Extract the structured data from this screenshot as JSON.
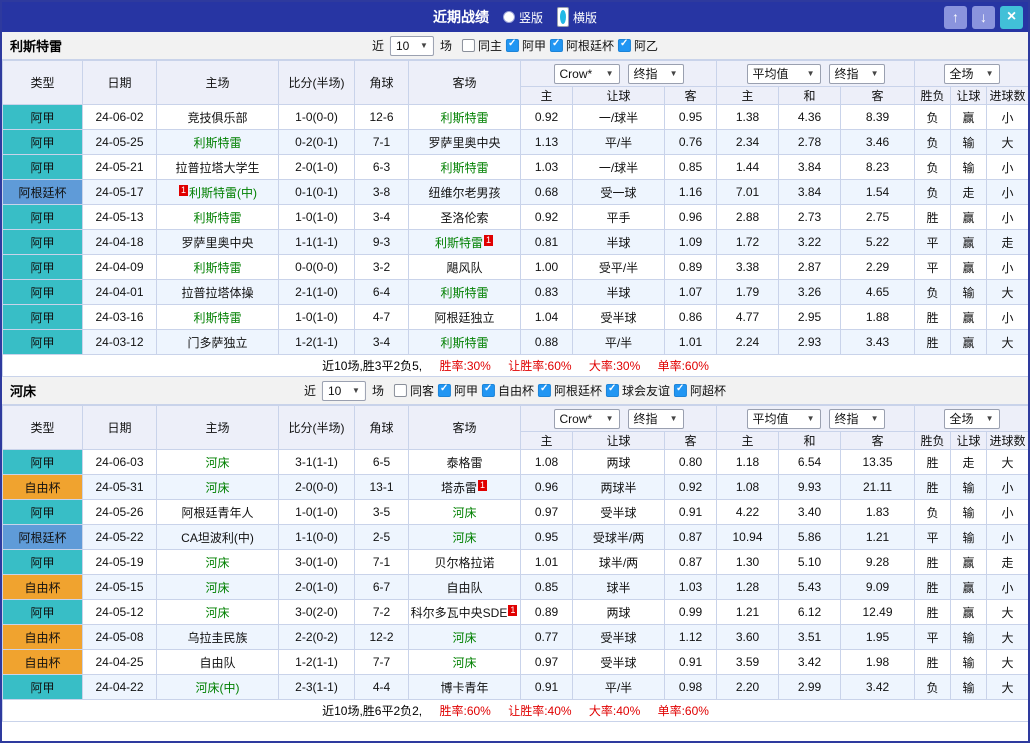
{
  "titlebar": {
    "title": "近期战绩",
    "vertical_label": "竖版",
    "horizontal_label": "横版",
    "selected_layout": "横版",
    "up_icon": "↑",
    "down_icon": "↓",
    "close_icon": "×"
  },
  "labels": {
    "recent_prefix": "近",
    "recent_suffix": "场"
  },
  "table_header": {
    "left_cols": [
      "类型",
      "日期",
      "主场",
      "比分(半场)",
      "角球",
      "客场"
    ],
    "company_select": "Crow*",
    "final_select": "终指",
    "avg_select": "平均值",
    "avg_final_select": "终指",
    "scope_select": "全场",
    "sub_cols": [
      "主",
      "让球",
      "客",
      "主",
      "和",
      "客",
      "胜负",
      "让球",
      "进球数"
    ]
  },
  "colors": {
    "titlebar_bg": "#2735a3",
    "nav_btn": "#8a94dd",
    "close_btn": "#41c0d8",
    "league": {
      "阿甲": "#38bec6",
      "阿根廷杯": "#5f9bd8",
      "自由杯": "#f0a32f",
      "阿乙": "#38bec6"
    },
    "focus_team": "#008000",
    "score": "#e00000",
    "win": "#e00000",
    "draw": "#008800",
    "loss": "#0000cc",
    "header_bg": "#edeff9",
    "row_alt": "#eef5fe"
  },
  "sections": [
    {
      "team": "利斯特雷",
      "matches_select": "10",
      "filters": [
        {
          "label": "同主",
          "checked": false
        },
        {
          "label": "阿甲",
          "checked": true
        },
        {
          "label": "阿根廷杯",
          "checked": true
        },
        {
          "label": "阿乙",
          "checked": true
        }
      ],
      "rows": [
        {
          "league": "阿甲",
          "date": "24-06-02",
          "home": {
            "name": "竞技俱乐部"
          },
          "score": "1-0(0-0)",
          "corners": "12-6",
          "away": {
            "name": "利斯特雷",
            "focus": true
          },
          "odds": [
            "0.92",
            "一/球半",
            "0.95"
          ],
          "avg": [
            "1.38",
            "4.36",
            "8.39"
          ],
          "results": [
            "负",
            "赢",
            "小"
          ]
        },
        {
          "league": "阿甲",
          "date": "24-05-25",
          "home": {
            "name": "利斯特雷",
            "focus": true
          },
          "score": "0-2(0-1)",
          "corners": "7-1",
          "away": {
            "name": "罗萨里奥中央"
          },
          "odds": [
            "1.13",
            "平/半",
            "0.76"
          ],
          "avg": [
            "2.34",
            "2.78",
            "3.46"
          ],
          "results": [
            "负",
            "输",
            "大"
          ]
        },
        {
          "league": "阿甲",
          "date": "24-05-21",
          "home": {
            "name": "拉普拉塔大学生"
          },
          "score": "2-0(1-0)",
          "corners": "6-3",
          "away": {
            "name": "利斯特雷",
            "focus": true
          },
          "odds": [
            "1.03",
            "一/球半",
            "0.85"
          ],
          "avg": [
            "1.44",
            "3.84",
            "8.23"
          ],
          "results": [
            "负",
            "输",
            "小"
          ]
        },
        {
          "league": "阿根廷杯",
          "date": "24-05-17",
          "home": {
            "name": "利斯特雷(中)",
            "focus": true,
            "badge_pos": "before",
            "badge_text": "1"
          },
          "score": "0-1(0-1)",
          "corners": "3-8",
          "away": {
            "name": "纽维尔老男孩"
          },
          "odds": [
            "0.68",
            "受一球",
            "1.16"
          ],
          "avg": [
            "7.01",
            "3.84",
            "1.54"
          ],
          "results": [
            "负",
            "走",
            "小"
          ]
        },
        {
          "league": "阿甲",
          "date": "24-05-13",
          "home": {
            "name": "利斯特雷",
            "focus": true
          },
          "score": "1-0(1-0)",
          "corners": "3-4",
          "away": {
            "name": "圣洛伦索"
          },
          "odds": [
            "0.92",
            "平手",
            "0.96"
          ],
          "avg": [
            "2.88",
            "2.73",
            "2.75"
          ],
          "results": [
            "胜",
            "赢",
            "小"
          ]
        },
        {
          "league": "阿甲",
          "date": "24-04-18",
          "home": {
            "name": "罗萨里奥中央"
          },
          "score": "1-1(1-1)",
          "corners": "9-3",
          "away": {
            "name": "利斯特雷",
            "focus": true,
            "badge_pos": "after",
            "badge_text": "1"
          },
          "odds": [
            "0.81",
            "半球",
            "1.09"
          ],
          "avg": [
            "1.72",
            "3.22",
            "5.22"
          ],
          "results": [
            "平",
            "赢",
            "走"
          ]
        },
        {
          "league": "阿甲",
          "date": "24-04-09",
          "home": {
            "name": "利斯特雷",
            "focus": true
          },
          "score": "0-0(0-0)",
          "corners": "3-2",
          "away": {
            "name": "飓风队"
          },
          "odds": [
            "1.00",
            "受平/半",
            "0.89"
          ],
          "avg": [
            "3.38",
            "2.87",
            "2.29"
          ],
          "results": [
            "平",
            "赢",
            "小"
          ]
        },
        {
          "league": "阿甲",
          "date": "24-04-01",
          "home": {
            "name": "拉普拉塔体操"
          },
          "score": "2-1(1-0)",
          "corners": "6-4",
          "away": {
            "name": "利斯特雷",
            "focus": true
          },
          "odds": [
            "0.83",
            "半球",
            "1.07"
          ],
          "avg": [
            "1.79",
            "3.26",
            "4.65"
          ],
          "results": [
            "负",
            "输",
            "大"
          ]
        },
        {
          "league": "阿甲",
          "date": "24-03-16",
          "home": {
            "name": "利斯特雷",
            "focus": true
          },
          "score": "1-0(1-0)",
          "corners": "4-7",
          "away": {
            "name": "阿根廷独立"
          },
          "odds": [
            "1.04",
            "受半球",
            "0.86"
          ],
          "avg": [
            "4.77",
            "2.95",
            "1.88"
          ],
          "results": [
            "胜",
            "赢",
            "小"
          ]
        },
        {
          "league": "阿甲",
          "date": "24-03-12",
          "home": {
            "name": "门多萨独立"
          },
          "score": "1-2(1-1)",
          "corners": "3-4",
          "away": {
            "name": "利斯特雷",
            "focus": true
          },
          "odds": [
            "0.88",
            "平/半",
            "1.01"
          ],
          "avg": [
            "2.24",
            "2.93",
            "3.43"
          ],
          "results": [
            "胜",
            "赢",
            "大"
          ]
        }
      ],
      "summary": {
        "intro": "近10场,胜3平2负5,",
        "stats": [
          "胜率:30%",
          "让胜率:60%",
          "大率:30%",
          "单率:60%"
        ]
      }
    },
    {
      "team": "河床",
      "matches_select": "10",
      "filters": [
        {
          "label": "同客",
          "checked": false
        },
        {
          "label": "阿甲",
          "checked": true
        },
        {
          "label": "自由杯",
          "checked": true
        },
        {
          "label": "阿根廷杯",
          "checked": true
        },
        {
          "label": "球会友谊",
          "checked": true
        },
        {
          "label": "阿超杯",
          "checked": true
        }
      ],
      "rows": [
        {
          "league": "阿甲",
          "date": "24-06-03",
          "home": {
            "name": "河床",
            "focus": true
          },
          "score": "3-1(1-1)",
          "corners": "6-5",
          "away": {
            "name": "泰格雷"
          },
          "odds": [
            "1.08",
            "两球",
            "0.80"
          ],
          "avg": [
            "1.18",
            "6.54",
            "13.35"
          ],
          "results": [
            "胜",
            "走",
            "大"
          ]
        },
        {
          "league": "自由杯",
          "date": "24-05-31",
          "home": {
            "name": "河床",
            "focus": true
          },
          "score": "2-0(0-0)",
          "corners": "13-1",
          "away": {
            "name": "塔赤雷",
            "badge_pos": "after",
            "badge_text": "1"
          },
          "odds": [
            "0.96",
            "两球半",
            "0.92"
          ],
          "avg": [
            "1.08",
            "9.93",
            "21.11"
          ],
          "results": [
            "胜",
            "输",
            "小"
          ]
        },
        {
          "league": "阿甲",
          "date": "24-05-26",
          "home": {
            "name": "阿根廷青年人"
          },
          "score": "1-0(1-0)",
          "corners": "3-5",
          "away": {
            "name": "河床",
            "focus": true
          },
          "odds": [
            "0.97",
            "受半球",
            "0.91"
          ],
          "avg": [
            "4.22",
            "3.40",
            "1.83"
          ],
          "results": [
            "负",
            "输",
            "小"
          ]
        },
        {
          "league": "阿根廷杯",
          "date": "24-05-22",
          "home": {
            "name": "CA坦波利(中)"
          },
          "score": "1-1(0-0)",
          "corners": "2-5",
          "away": {
            "name": "河床",
            "focus": true
          },
          "odds": [
            "0.95",
            "受球半/两",
            "0.87"
          ],
          "avg": [
            "10.94",
            "5.86",
            "1.21"
          ],
          "results": [
            "平",
            "输",
            "小"
          ]
        },
        {
          "league": "阿甲",
          "date": "24-05-19",
          "home": {
            "name": "河床",
            "focus": true
          },
          "score": "3-0(1-0)",
          "corners": "7-1",
          "away": {
            "name": "贝尔格拉诺"
          },
          "odds": [
            "1.01",
            "球半/两",
            "0.87"
          ],
          "avg": [
            "1.30",
            "5.10",
            "9.28"
          ],
          "results": [
            "胜",
            "赢",
            "走"
          ]
        },
        {
          "league": "自由杯",
          "date": "24-05-15",
          "home": {
            "name": "河床",
            "focus": true
          },
          "score": "2-0(1-0)",
          "corners": "6-7",
          "away": {
            "name": "自由队"
          },
          "odds": [
            "0.85",
            "球半",
            "1.03"
          ],
          "avg": [
            "1.28",
            "5.43",
            "9.09"
          ],
          "results": [
            "胜",
            "赢",
            "小"
          ]
        },
        {
          "league": "阿甲",
          "date": "24-05-12",
          "home": {
            "name": "河床",
            "focus": true
          },
          "score": "3-0(2-0)",
          "corners": "7-2",
          "away": {
            "name": "科尔多瓦中央SDE",
            "badge_pos": "after",
            "badge_text": "1"
          },
          "odds": [
            "0.89",
            "两球",
            "0.99"
          ],
          "avg": [
            "1.21",
            "6.12",
            "12.49"
          ],
          "results": [
            "胜",
            "赢",
            "大"
          ]
        },
        {
          "league": "自由杯",
          "date": "24-05-08",
          "home": {
            "name": "乌拉圭民族"
          },
          "score": "2-2(0-2)",
          "corners": "12-2",
          "away": {
            "name": "河床",
            "focus": true
          },
          "odds": [
            "0.77",
            "受半球",
            "1.12"
          ],
          "avg": [
            "3.60",
            "3.51",
            "1.95"
          ],
          "results": [
            "平",
            "输",
            "大"
          ]
        },
        {
          "league": "自由杯",
          "date": "24-04-25",
          "home": {
            "name": "自由队"
          },
          "score": "1-2(1-1)",
          "corners": "7-7",
          "away": {
            "name": "河床",
            "focus": true
          },
          "odds": [
            "0.97",
            "受半球",
            "0.91"
          ],
          "avg": [
            "3.59",
            "3.42",
            "1.98"
          ],
          "results": [
            "胜",
            "输",
            "大"
          ]
        },
        {
          "league": "阿甲",
          "date": "24-04-22",
          "home": {
            "name": "河床(中)",
            "focus": true
          },
          "score": "2-3(1-1)",
          "corners": "4-4",
          "away": {
            "name": "博卡青年"
          },
          "odds": [
            "0.91",
            "平/半",
            "0.98"
          ],
          "avg": [
            "2.20",
            "2.99",
            "3.42"
          ],
          "results": [
            "负",
            "输",
            "大"
          ]
        }
      ],
      "summary": {
        "intro": "近10场,胜6平2负2,",
        "stats": [
          "胜率:60%",
          "让胜率:40%",
          "大率:40%",
          "单率:60%"
        ]
      }
    }
  ]
}
